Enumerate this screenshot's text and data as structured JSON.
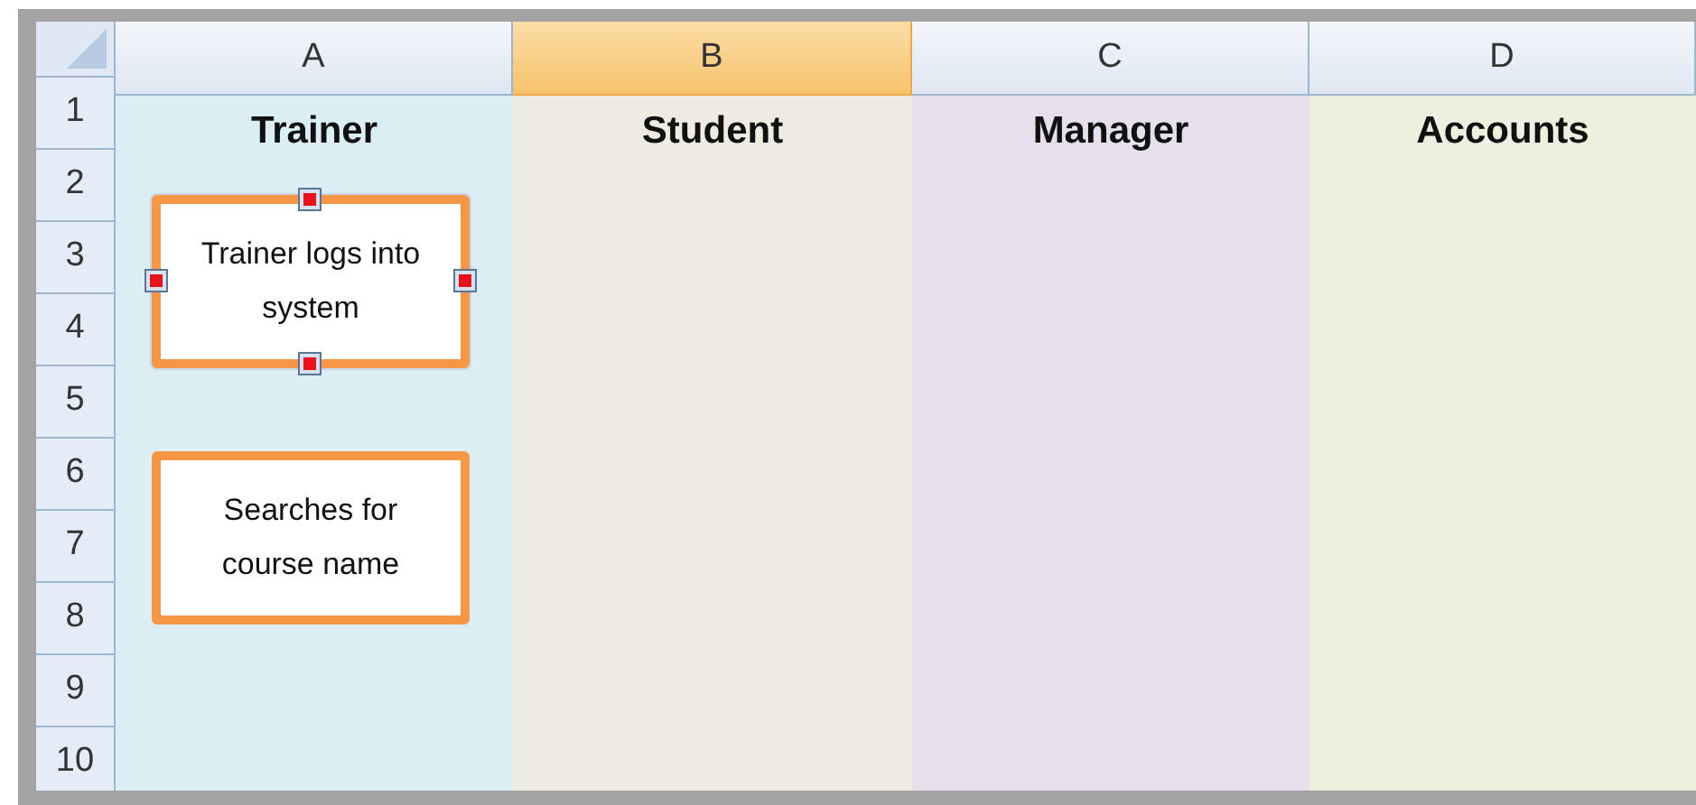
{
  "columns": [
    {
      "letter": "A",
      "selected": false,
      "color": "#dbeef4",
      "heading": "Trainer",
      "shapes": [
        {
          "text": "Trainer logs into system",
          "selected": true
        },
        {
          "text": "Searches for course name",
          "selected": false
        }
      ]
    },
    {
      "letter": "B",
      "selected": true,
      "color": "#eeece1",
      "heading": "Student"
    },
    {
      "letter": "C",
      "selected": false,
      "color": "#e5e0ec",
      "heading": "Manager"
    },
    {
      "letter": "D",
      "selected": false,
      "color": "#ebf1de",
      "heading": "Accounts"
    }
  ],
  "rows": [
    "1",
    "2",
    "3",
    "4",
    "5",
    "6",
    "7",
    "8",
    "9",
    "10"
  ]
}
